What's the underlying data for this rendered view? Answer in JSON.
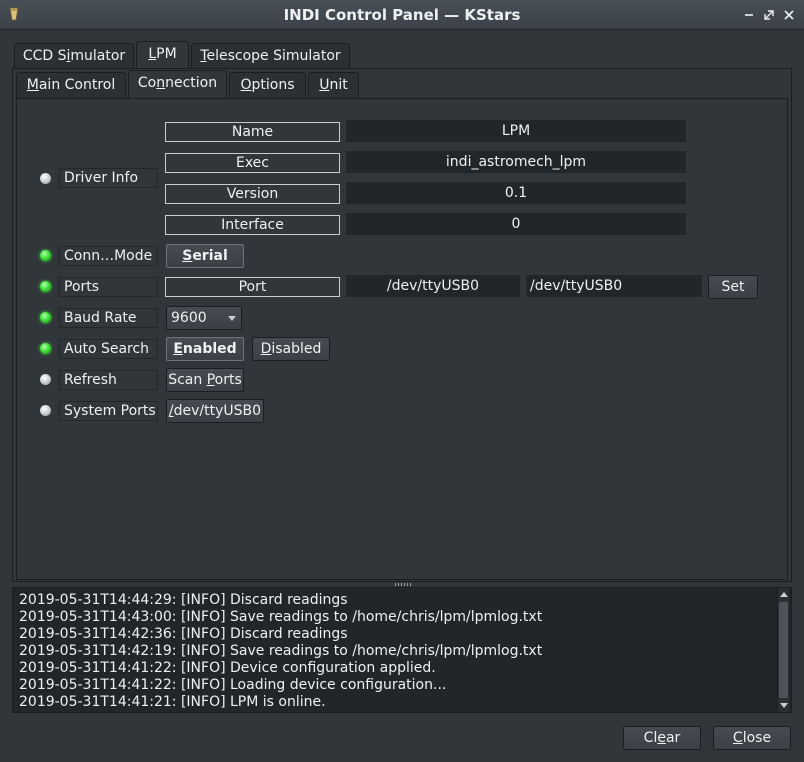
{
  "window": {
    "title": "INDI Control Panel — KStars",
    "minimize_icon": "minimize-icon",
    "restore_icon": "restore-icon",
    "close_icon": "close-icon"
  },
  "device_tabs": [
    {
      "pre": "CCD S",
      "ul": "i",
      "post": "mulator"
    },
    {
      "pre": "",
      "ul": "L",
      "post": "PM"
    },
    {
      "pre": "",
      "ul": "T",
      "post": "elescope Simulator"
    }
  ],
  "group_tabs": [
    {
      "pre": "",
      "ul": "M",
      "post": "ain Control"
    },
    {
      "pre": "Co",
      "ul": "n",
      "post": "nection"
    },
    {
      "pre": "",
      "ul": "O",
      "post": "ptions"
    },
    {
      "pre": "",
      "ul": "U",
      "post": "nit"
    }
  ],
  "colors": {
    "led_ok": "#3fe03a",
    "led_idle": "#cfd3d6"
  },
  "properties": {
    "driver_info": {
      "label": "Driver Info",
      "state": "idle",
      "rows": [
        {
          "name": "Name",
          "value": "LPM"
        },
        {
          "name": "Exec",
          "value": "indi_astromech_lpm"
        },
        {
          "name": "Version",
          "value": "0.1"
        },
        {
          "name": "Interface",
          "value": "0"
        }
      ]
    },
    "conn_mode": {
      "label": "Conn…Mode",
      "state": "ok",
      "button": {
        "pre": "",
        "ul": "S",
        "post": "erial"
      }
    },
    "ports": {
      "label": "Ports",
      "state": "ok",
      "name": "Port",
      "value": "/dev/ttyUSB0",
      "input": "/dev/ttyUSB0",
      "set_label": "Set"
    },
    "baud_rate": {
      "label": "Baud Rate",
      "state": "ok",
      "selected": "9600"
    },
    "auto_search": {
      "label": "Auto Search",
      "state": "ok",
      "enabled": {
        "pre": "",
        "ul": "E",
        "post": "nabled"
      },
      "disabled": {
        "pre": "",
        "ul": "D",
        "post": "isabled"
      }
    },
    "refresh": {
      "label": "Refresh",
      "state": "idle",
      "button": {
        "pre": "Scan ",
        "ul": "P",
        "post": "orts"
      }
    },
    "system_ports": {
      "label": "System Ports",
      "state": "idle",
      "button": {
        "pre": "",
        "ul": "/",
        "post": "dev/ttyUSB0"
      }
    }
  },
  "log": [
    "2019-05-31T14:44:29: [INFO] Discard readings",
    "2019-05-31T14:43:00: [INFO] Save readings to /home/chris/lpm/lpmlog.txt",
    "2019-05-31T14:42:36: [INFO] Discard readings",
    "2019-05-31T14:42:19: [INFO] Save readings to /home/chris/lpm/lpmlog.txt",
    "2019-05-31T14:41:22: [INFO] Device configuration applied.",
    "2019-05-31T14:41:22: [INFO] Loading device configuration...",
    "2019-05-31T14:41:21: [INFO] LPM is online."
  ],
  "footer": {
    "clear": {
      "pre": "Cl",
      "ul": "e",
      "post": "ar"
    },
    "close": {
      "pre": "",
      "ul": "C",
      "post": "lose"
    }
  }
}
